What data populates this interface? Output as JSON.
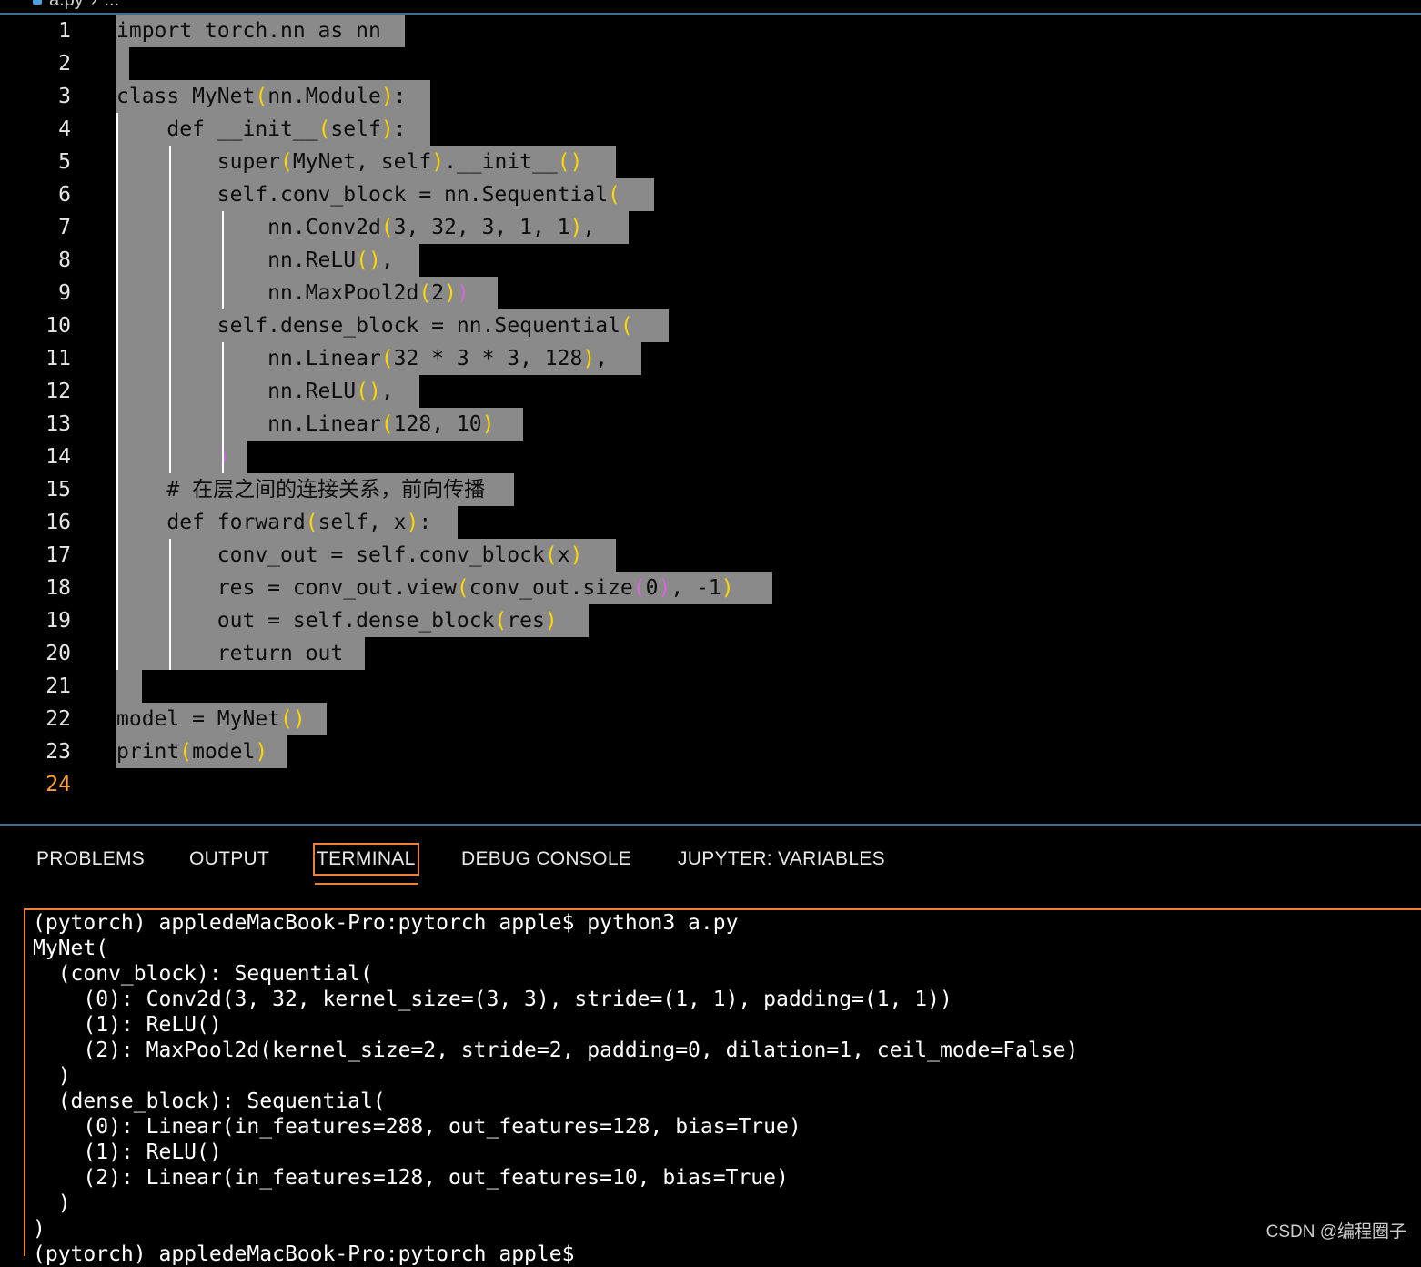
{
  "breadcrumb": {
    "file": "a.py",
    "sep": "›",
    "more": "..."
  },
  "editor": {
    "current_line": 24,
    "lines": [
      {
        "n": "1",
        "t": "import torch.nn as nn"
      },
      {
        "n": "2",
        "t": ""
      },
      {
        "n": "3",
        "t": "class MyNet(nn.Module):"
      },
      {
        "n": "4",
        "t": "    def __init__(self):"
      },
      {
        "n": "5",
        "t": "        super(MyNet, self).__init__()"
      },
      {
        "n": "6",
        "t": "        self.conv_block = nn.Sequential("
      },
      {
        "n": "7",
        "t": "            nn.Conv2d(3, 32, 3, 1, 1),"
      },
      {
        "n": "8",
        "t": "            nn.ReLU(),"
      },
      {
        "n": "9",
        "t": "            nn.MaxPool2d(2))"
      },
      {
        "n": "10",
        "t": "        self.dense_block = nn.Sequential("
      },
      {
        "n": "11",
        "t": "            nn.Linear(32 * 3 * 3, 128),"
      },
      {
        "n": "12",
        "t": "            nn.ReLU(),"
      },
      {
        "n": "13",
        "t": "            nn.Linear(128, 10)"
      },
      {
        "n": "14",
        "t": "        )"
      },
      {
        "n": "15",
        "t": "    # 在层之间的连接关系，前向传播"
      },
      {
        "n": "16",
        "t": "    def forward(self, x):"
      },
      {
        "n": "17",
        "t": "        conv_out = self.conv_block(x)"
      },
      {
        "n": "18",
        "t": "        res = conv_out.view(conv_out.size(0), -1)"
      },
      {
        "n": "19",
        "t": "        out = self.dense_block(res)"
      },
      {
        "n": "20",
        "t": "        return out"
      },
      {
        "n": "21",
        "t": ""
      },
      {
        "n": "22",
        "t": "model = MyNet()"
      },
      {
        "n": "23",
        "t": "print(model)"
      },
      {
        "n": "24",
        "t": ""
      }
    ]
  },
  "panel": {
    "tabs": [
      "PROBLEMS",
      "OUTPUT",
      "TERMINAL",
      "DEBUG CONSOLE",
      "JUPYTER: VARIABLES"
    ],
    "active_tab": "TERMINAL"
  },
  "terminal": {
    "lines": [
      "(pytorch) appledeMacBook-Pro:pytorch apple$ python3 a.py",
      "MyNet(",
      "  (conv_block): Sequential(",
      "    (0): Conv2d(3, 32, kernel_size=(3, 3), stride=(1, 1), padding=(1, 1))",
      "    (1): ReLU()",
      "    (2): MaxPool2d(kernel_size=2, stride=2, padding=0, dilation=1, ceil_mode=False)",
      "  )",
      "  (dense_block): Sequential(",
      "    (0): Linear(in_features=288, out_features=128, bias=True)",
      "    (1): ReLU()",
      "    (2): Linear(in_features=128, out_features=10, bias=True)",
      "  )",
      ")",
      "(pytorch) appledeMacBook-Pro:pytorch apple$"
    ]
  },
  "watermark": "CSDN @编程圈子",
  "colors": {
    "accent": "#e8813a",
    "selection": "#8a8a8a",
    "bracket1": "#ffd600",
    "bracket2": "#d46ad8",
    "current_line_number": "#ff9d2f"
  }
}
